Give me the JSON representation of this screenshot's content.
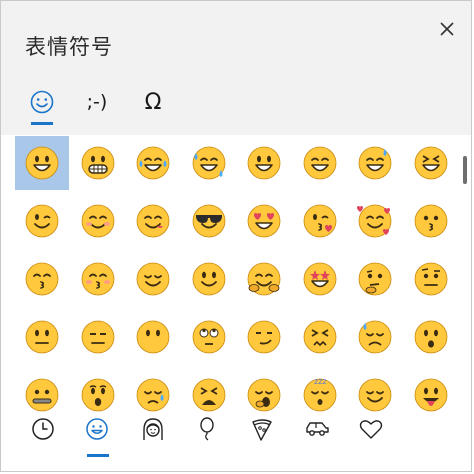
{
  "panel": {
    "title": "表情符号",
    "close_label": "✕"
  },
  "tabs": [
    {
      "label": "☺",
      "icon": "smiley-face-icon",
      "active": true
    },
    {
      "label": ";-)",
      "icon": "kaomoji-icon",
      "active": false
    },
    {
      "label": "Ω",
      "icon": "symbols-omega-icon",
      "active": false
    }
  ],
  "emoji_grid": [
    [
      "grinning-face",
      "grimacing-face",
      "face-with-tears-of-joy",
      "rolling-on-floor-laughing",
      "smiling-face-open-mouth",
      "grinning-smiling-eyes",
      "grinning-sweat",
      "squinting-face"
    ],
    [
      "winking-face",
      "smiling-blush",
      "face-savoring-food",
      "smiling-sunglasses",
      "heart-eyes",
      "kissing-heart",
      "smiling-hearts",
      "kissing-face"
    ],
    [
      "kissing-closed-eyes",
      "kissing-smiling-eyes",
      "relieved-face",
      "slightly-smiling",
      "hugging-face",
      "star-struck",
      "thinking-face",
      "neutral-raised-brow"
    ],
    [
      "neutral-face",
      "expressionless-face",
      "no-mouth-face",
      "rolling-eyes",
      "smirking-face",
      "persevering-face",
      "sad-sweat",
      "hushed-face"
    ],
    [
      "zipper-mouth",
      "surprised-face",
      "sleepy-face",
      "tired-face",
      "yawning-face",
      "sleeping-face",
      "relieved-closed",
      "tongue-out"
    ]
  ],
  "selected_emoji": "grinning-face",
  "bottom_tabs": [
    {
      "name": "recent",
      "icon": "clock-icon",
      "active": false
    },
    {
      "name": "smileys",
      "icon": "smiley-outline-icon",
      "active": true
    },
    {
      "name": "people",
      "icon": "person-icon",
      "active": false
    },
    {
      "name": "celebration",
      "icon": "balloon-icon",
      "active": false
    },
    {
      "name": "food",
      "icon": "pizza-icon",
      "active": false
    },
    {
      "name": "travel",
      "icon": "car-icon",
      "active": false
    },
    {
      "name": "symbols",
      "icon": "heart-icon",
      "active": false
    }
  ],
  "colors": {
    "accent": "#1a74c9",
    "emoji_face": "#ffc83d",
    "selection": "#a9c7e8"
  }
}
